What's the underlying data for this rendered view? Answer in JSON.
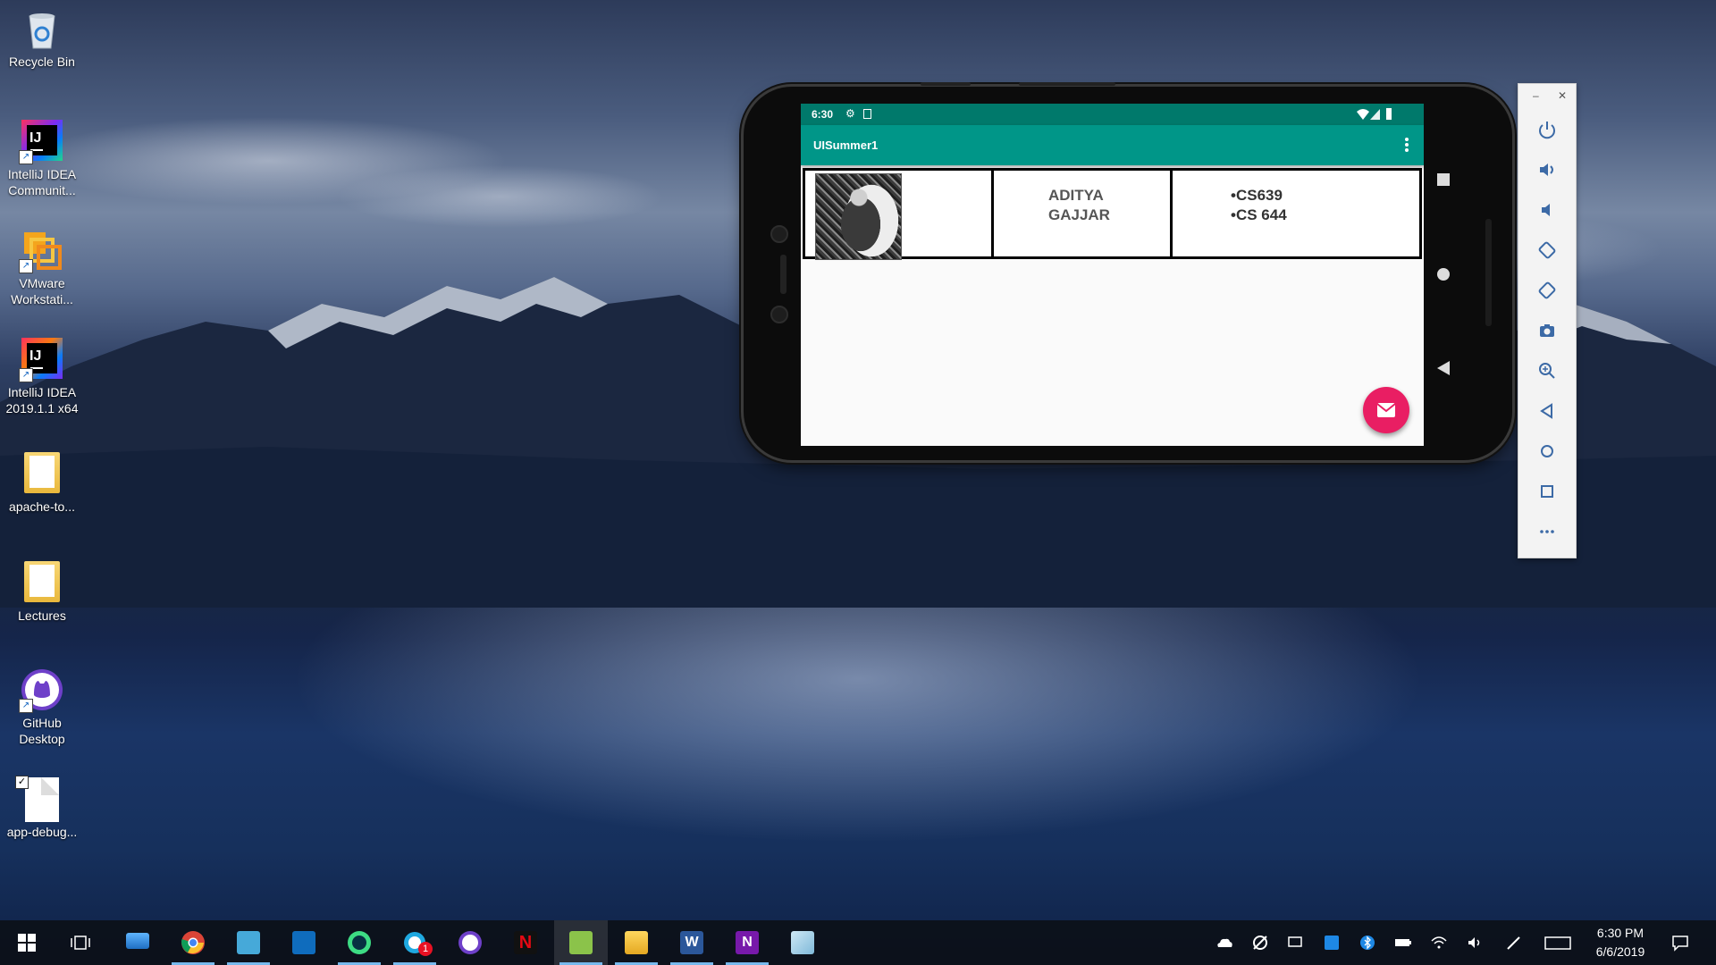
{
  "desktop": {
    "icons": [
      {
        "label_lines": [
          "Recycle Bin"
        ]
      },
      {
        "label_lines": [
          "IntelliJ IDEA",
          "Communit..."
        ]
      },
      {
        "label_lines": [
          "VMware",
          "Workstati..."
        ]
      },
      {
        "label_lines": [
          "IntelliJ IDEA",
          "2019.1.1 x64"
        ]
      },
      {
        "label_lines": [
          "apache-to..."
        ]
      },
      {
        "label_lines": [
          "Lectures"
        ]
      },
      {
        "label_lines": [
          "GitHub",
          "Desktop"
        ]
      },
      {
        "label_lines": [
          "app-debug..."
        ]
      }
    ]
  },
  "emulator": {
    "status": {
      "time": "6:30",
      "icons": [
        "gear-icon",
        "sim-icon",
        "wifi-icon",
        "signal-icon",
        "battery-icon"
      ]
    },
    "app_title": "UISummer1",
    "profile": {
      "name_line1": "ADITYA",
      "name_line2": "GAJJAR",
      "course1": "•CS639",
      "course2": "•CS 644"
    },
    "fab_icon": "email-icon",
    "toolbar_icons": [
      "minimize-icon",
      "close-icon",
      "power-icon",
      "volume-up-icon",
      "volume-down-icon",
      "rotate-left-icon",
      "rotate-right-icon",
      "camera-icon",
      "zoom-icon",
      "back-icon",
      "home-icon",
      "overview-icon",
      "more-icon"
    ],
    "accent": "#009688",
    "status_color": "#00796b",
    "fab_color": "#e91e63"
  },
  "taskbar": {
    "apps": [
      "windows-start-icon",
      "task-view-icon",
      "laptop-icon",
      "chrome-icon",
      "notepad-icon",
      "outlook-icon",
      "android-studio-icon",
      "whatsapp-icon",
      "github-icon",
      "netflix-icon",
      "emulator-icon",
      "file-explorer-icon",
      "word-icon",
      "onenote-icon",
      "notes-icon"
    ],
    "whatsapp_badge": "1",
    "time": "6:30 PM",
    "date": "6/6/2019"
  }
}
